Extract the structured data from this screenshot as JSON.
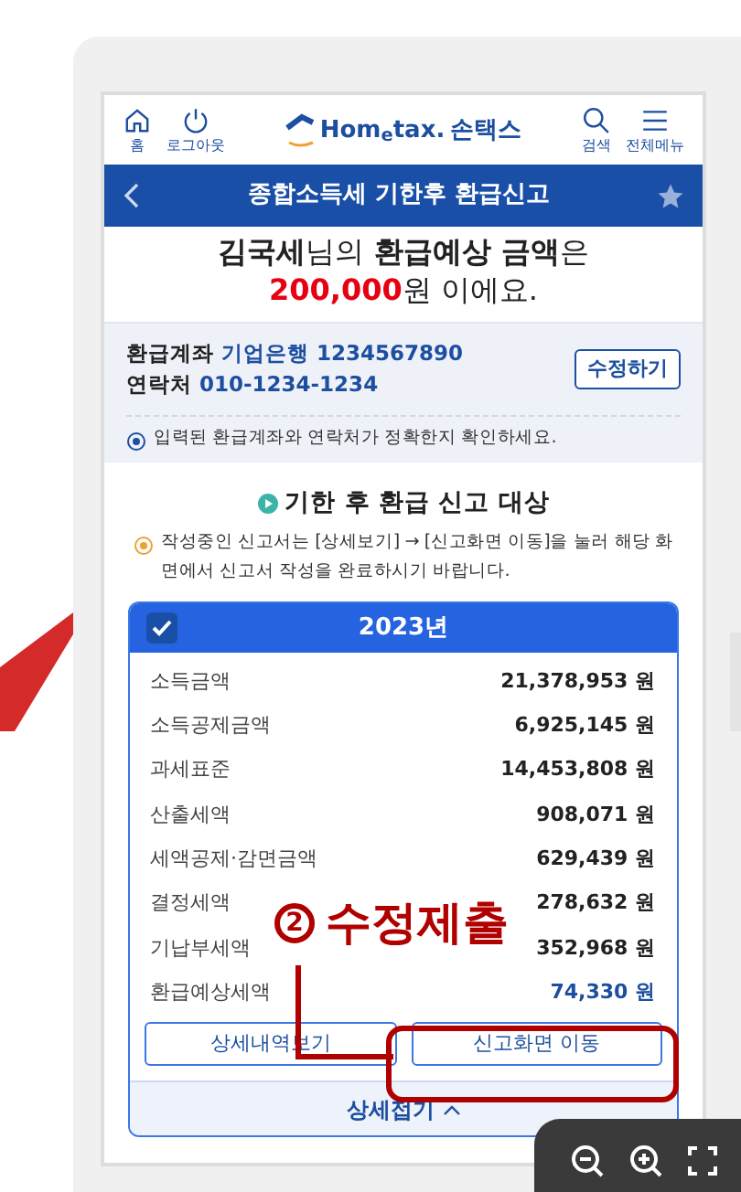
{
  "header": {
    "left_actions": [
      {
        "kind": "home",
        "label": "홈"
      },
      {
        "kind": "power",
        "label": "로그아웃"
      }
    ],
    "logo": {
      "text": "Hom$_{e}$tax.",
      "brand": "손택스"
    },
    "right_actions": [
      {
        "kind": "search",
        "label": "검색"
      },
      {
        "kind": "menu",
        "label": "전체메뉴"
      }
    ]
  },
  "title_bar": {
    "title": "종합소득세 기한후 환급신고"
  },
  "greeting": {
    "line1": "**김국세**님의 **환급예상 금액**은",
    "amount": "200,000",
    "line2_rest": "원 이에요."
  },
  "account": {
    "rows": [
      {
        "label": "환급계좌",
        "value": "기업은행 1234567890"
      },
      {
        "label": "연락처",
        "value": "010-1234-1234"
      }
    ],
    "edit_button": "수정하기",
    "notice": "입력된 환급계좌와 연락처가 정확한지 확인하세요."
  },
  "target": {
    "title": "기한 후 환급 신고 대상",
    "notice": "작성중인 신고서는 [상세보기] → [신고화면 이동]을 눌러 해당 화면에서 신고서 작성을 완료하시기 바랍니다."
  },
  "year_card": {
    "year": "2023년",
    "checked": true,
    "rows": [
      {
        "label": "소득금액",
        "value": "21,378,953",
        "unit": "원",
        "highlight": false
      },
      {
        "label": "소득공제금액",
        "value": "6,925,145",
        "unit": "원",
        "highlight": false
      },
      {
        "label": "과세표준",
        "value": "14,453,808",
        "unit": "원",
        "highlight": false
      },
      {
        "label": "산출세액",
        "value": "908,071",
        "unit": "원",
        "highlight": false
      },
      {
        "label": "세액공제·감면금액",
        "value": "629,439",
        "unit": "원",
        "highlight": false
      },
      {
        "label": "결정세액",
        "value": "278,632",
        "unit": "원",
        "highlight": false
      },
      {
        "label": "기납부세액",
        "value": "352,968",
        "unit": "원",
        "highlight": false
      },
      {
        "label": "환급예상세액",
        "value": "74,330",
        "unit": "원",
        "highlight": true
      }
    ],
    "buttons": [
      "상세내역보기",
      "신고화면 이동"
    ],
    "collapse": "상세접기"
  },
  "annotation": {
    "number": "2",
    "text": "수정제출"
  }
}
